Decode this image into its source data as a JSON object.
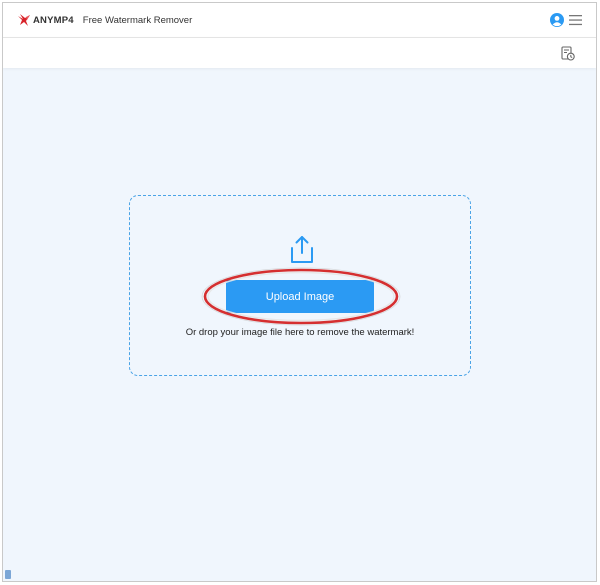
{
  "header": {
    "brand": "ANYMP4",
    "title": "Free Watermark Remover",
    "user_icon": "user-avatar-icon",
    "menu_icon": "hamburger-menu-icon"
  },
  "toolbar": {
    "history_icon": "history-icon"
  },
  "upload": {
    "icon": "upload-icon",
    "button_label": "Upload Image",
    "hint": "Or drop your image file here to remove the watermark!"
  },
  "colors": {
    "accent": "#2b9af3",
    "page_background": "#f0f6fd",
    "dropzone_border": "#4aa3e6",
    "highlight_ring": "#d11a1a",
    "logo": "#d8232a"
  }
}
